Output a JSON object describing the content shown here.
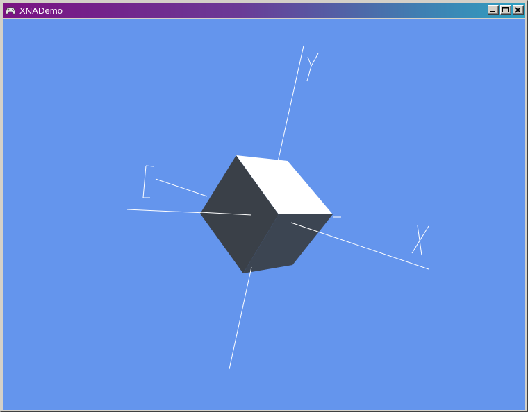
{
  "window": {
    "title": "XNADemo",
    "app_icon": "gamepad-icon",
    "controls": {
      "minimize_icon": "minimize-icon",
      "maximize_icon": "maximize-icon",
      "close_icon": "close-icon"
    }
  },
  "scene": {
    "background_color": "#6495ed",
    "axis_color": "#ffffff",
    "cube_colors": {
      "top": "#ffffff",
      "left": "#3a4048",
      "front": "#3c4552"
    },
    "axes": [
      {
        "name": "X",
        "label_glyph": "x-axis-label"
      },
      {
        "name": "Y",
        "label_glyph": "y-axis-label"
      },
      {
        "name": "Z",
        "label_glyph": "z-axis-label"
      }
    ]
  }
}
